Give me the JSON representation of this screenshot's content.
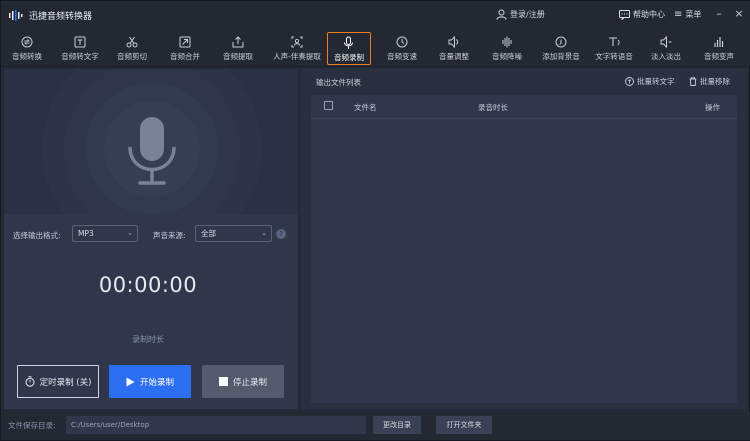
{
  "app": {
    "title": "迅捷音频转换器"
  },
  "header": {
    "login": "登录/注册",
    "help": "帮助中心",
    "menu": "菜单"
  },
  "toolbar": {
    "items": [
      {
        "label": "音频转换",
        "icon": "convert-icon"
      },
      {
        "label": "音频转文字",
        "icon": "audio-to-text-icon"
      },
      {
        "label": "音频剪切",
        "icon": "scissors-icon"
      },
      {
        "label": "音频合并",
        "icon": "merge-icon"
      },
      {
        "label": "音频提取",
        "icon": "extract-icon"
      },
      {
        "label": "人声-伴奏提取",
        "icon": "vocal-extract-icon"
      },
      {
        "label": "音频录制",
        "icon": "mic-icon",
        "active": true
      },
      {
        "label": "音频变速",
        "icon": "speed-icon"
      },
      {
        "label": "音量调整",
        "icon": "volume-icon"
      },
      {
        "label": "音频降噪",
        "icon": "denoise-icon"
      },
      {
        "label": "添加背景音",
        "icon": "background-music-icon"
      },
      {
        "label": "文字转语音",
        "icon": "text-to-speech-icon"
      },
      {
        "label": "淡入淡出",
        "icon": "fade-icon"
      },
      {
        "label": "音频变声",
        "icon": "voice-change-icon"
      }
    ]
  },
  "recorder": {
    "format_label": "选择输出格式:",
    "format_value": "MP3",
    "source_label": "声音来源:",
    "source_value": "全部",
    "timer": "00:00:00",
    "timer_label": "录制时长",
    "btn_timer": "定时录制 (关)",
    "btn_start": "开始录制",
    "btn_stop": "停止录制"
  },
  "output": {
    "title": "输出文件列表",
    "batch_to_text": "批量转文字",
    "batch_remove": "批量移除",
    "columns": [
      "文件名",
      "录音时长",
      "操作"
    ]
  },
  "footer": {
    "save_label": "文件保存目录:",
    "path": "C:/Users/user/Desktop",
    "change_dir": "更改目录",
    "open_folder": "打开文件夹"
  },
  "colors": {
    "accent": "#2b6ff0",
    "active_border": "#f07d1e",
    "bg": "#2b3040"
  }
}
